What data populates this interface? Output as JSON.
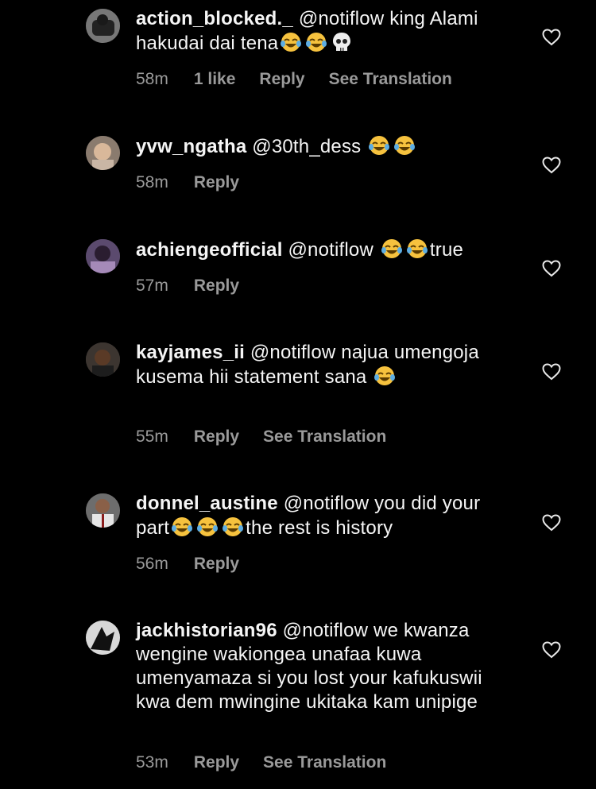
{
  "comments": [
    {
      "username": "action_blocked._",
      "text": "@notiflow king Alami hakudai dai tena",
      "emojis": [
        "laughing-face",
        "laughing-face",
        "skull"
      ],
      "time": "58m",
      "likes": "1 like",
      "reply": "Reply",
      "translation": "See Translation"
    },
    {
      "username": "yvw_ngatha",
      "text": "@30th_dess",
      "emojis": [
        "laughing-face",
        "laughing-face"
      ],
      "time": "58m",
      "reply": "Reply"
    },
    {
      "username": "achiengeofficial",
      "text": "@notiflow",
      "emojis": [
        "laughing-face",
        "laughing-face"
      ],
      "text_after": "true",
      "time": "57m",
      "reply": "Reply"
    },
    {
      "username": "kayjames_ii",
      "text": "@notiflow najua umengoja kusema hii statement sana",
      "emojis": [
        "laughing-face"
      ],
      "time": "55m",
      "reply": "Reply",
      "translation": "See Translation"
    },
    {
      "username": "donnel_austine",
      "text": "@notiflow you did your part",
      "emojis": [
        "laughing-face",
        "laughing-face",
        "laughing-face"
      ],
      "text_after": "the rest is history",
      "time": "56m",
      "reply": "Reply"
    },
    {
      "username": "jackhistorian96",
      "text": "@notiflow we kwanza wengine wakiongea unafaa kuwa umenyamaza si you lost your kafukuswii kwa dem mwingine ukitaka kam unipige",
      "time": "53m",
      "reply": "Reply",
      "translation": "See Translation"
    }
  ]
}
